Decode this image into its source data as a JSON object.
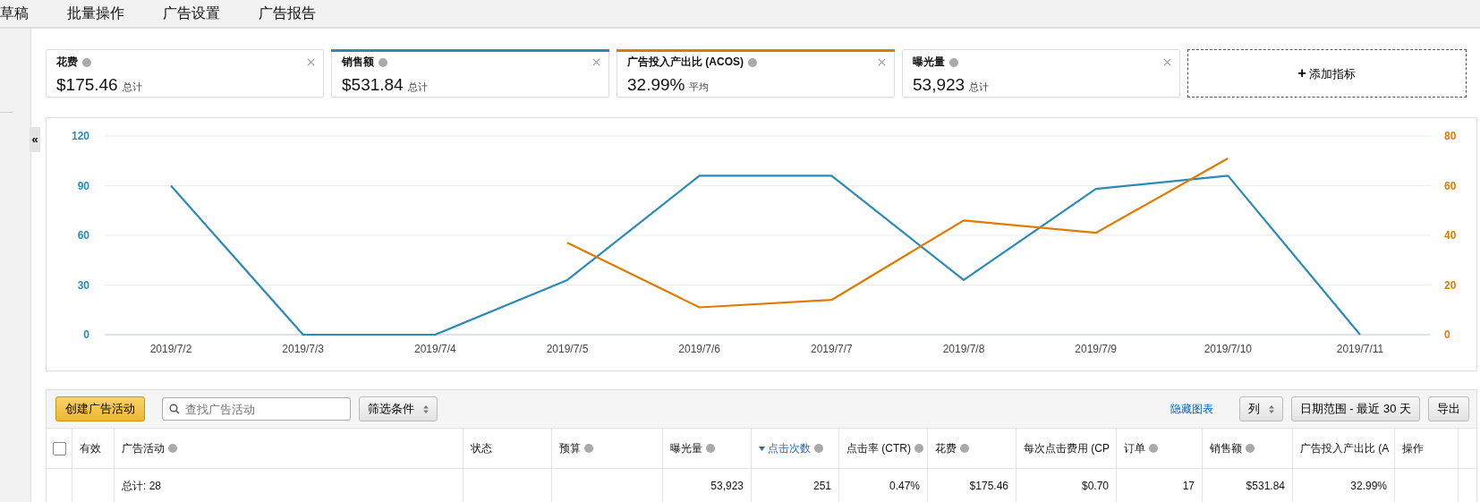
{
  "nav": [
    {
      "label": "草稿"
    },
    {
      "label": "批量操作"
    },
    {
      "label": "广告设置"
    },
    {
      "label": "广告报告"
    }
  ],
  "sidebar": {
    "collapse": "«"
  },
  "metrics": [
    {
      "label": "花费",
      "value": "$175.46",
      "unit": "总计",
      "selected": false
    },
    {
      "label": "销售额",
      "value": "$531.84",
      "unit": "总计",
      "selected": true,
      "color": "#2b8ab8"
    },
    {
      "label": "广告投入产出比 (ACOS)",
      "value": "32.99%",
      "unit": "平均",
      "selected": true,
      "color": "#e07b00"
    },
    {
      "label": "曝光量",
      "value": "53,923",
      "unit": "总计",
      "selected": false
    }
  ],
  "add_metric": {
    "icon": "+",
    "label": "添加指标"
  },
  "chart_data": {
    "type": "line",
    "categories": [
      "2019/7/2",
      "2019/7/3",
      "2019/7/4",
      "2019/7/5",
      "2019/7/6",
      "2019/7/7",
      "2019/7/8",
      "2019/7/9",
      "2019/7/10",
      "2019/7/11"
    ],
    "series": [
      {
        "color": "#2b8ab8",
        "values": [
          90,
          0,
          0,
          33,
          96,
          96,
          33,
          88,
          96,
          0
        ]
      },
      {
        "color": "#e07b00",
        "axis": "y2",
        "values": [
          null,
          null,
          null,
          37,
          11,
          14,
          46,
          41,
          71,
          null
        ]
      }
    ],
    "grid": true,
    "ylim": [
      0,
      120
    ],
    "yticks": [
      0,
      30,
      60,
      90,
      120
    ],
    "y2lim": [
      0,
      80
    ],
    "y2ticks": [
      0,
      20,
      40,
      60,
      80
    ]
  },
  "toolbar": {
    "create": "创建广告活动",
    "search_placeholder": "查找广告活动",
    "filter": "筛选条件",
    "hide_chart": "隐藏图表",
    "columns": "列",
    "date_range": "日期范围 - 最近 30 天",
    "export": "导出"
  },
  "table": {
    "select_all_checked": false,
    "columns": [
      {
        "label": "有效",
        "info": false,
        "sorted": false
      },
      {
        "label": "广告活动",
        "info": true,
        "sorted": false,
        "total": "总计: 28"
      },
      {
        "label": "状态",
        "info": false,
        "sorted": false
      },
      {
        "label": "预算",
        "info": true,
        "sorted": false
      },
      {
        "label": "曝光量",
        "info": true,
        "sorted": false,
        "total": "53,923"
      },
      {
        "label": "点击次数",
        "info": true,
        "sorted": true,
        "total": "251"
      },
      {
        "label": "点击率 (CTR)",
        "info": true,
        "sorted": false,
        "total": "0.47%"
      },
      {
        "label": "花费",
        "info": true,
        "sorted": false,
        "total": "$175.46"
      },
      {
        "label": "每次点击费用 (CP",
        "sorted": false,
        "total": "$0.70"
      },
      {
        "label": "订单",
        "info": true,
        "sorted": false,
        "total": "17"
      },
      {
        "label": "销售额",
        "info": true,
        "sorted": false,
        "total": "$531.84"
      },
      {
        "label": "广告投入产出比 (A",
        "sorted": false,
        "total": "32.99%"
      },
      {
        "label": "操作",
        "info": false,
        "sorted": false
      }
    ]
  }
}
